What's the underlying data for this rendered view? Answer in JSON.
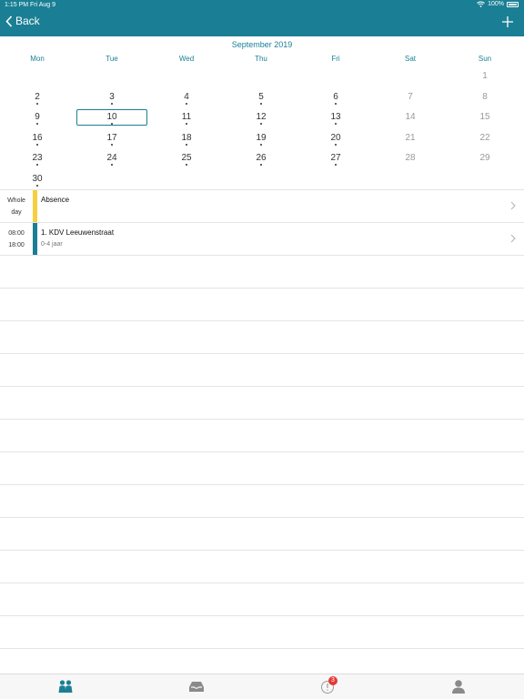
{
  "status_bar": {
    "time": "1:15 PM",
    "date": "Fri Aug 9",
    "battery": "100%"
  },
  "nav": {
    "back_label": "Back",
    "add_icon": "plus-icon"
  },
  "calendar": {
    "month": "September 2019",
    "weekdays": [
      "Mon",
      "Tue",
      "Wed",
      "Thu",
      "Fri",
      "Sat",
      "Sun"
    ],
    "selected_day": "10",
    "weeks": [
      [
        "",
        "",
        "",
        "",
        "",
        "",
        "1"
      ],
      [
        "2",
        "3",
        "4",
        "5",
        "6",
        "7",
        "8"
      ],
      [
        "9",
        "10",
        "11",
        "12",
        "13",
        "14",
        "15"
      ],
      [
        "16",
        "17",
        "18",
        "19",
        "20",
        "21",
        "22"
      ],
      [
        "23",
        "24",
        "25",
        "26",
        "27",
        "28",
        "29"
      ],
      [
        "30",
        "",
        "",
        "",
        "",
        "",
        ""
      ]
    ],
    "days_with_events": [
      "2",
      "3",
      "4",
      "5",
      "6",
      "9",
      "10",
      "11",
      "12",
      "13",
      "16",
      "17",
      "18",
      "19",
      "20",
      "23",
      "24",
      "25",
      "26",
      "27",
      "30"
    ]
  },
  "events": [
    {
      "time1": "Whole",
      "time2": "day",
      "title": "Absence",
      "subtitle": "",
      "color": "#f4d03f"
    },
    {
      "time1": "08:00",
      "time2": "18:00",
      "title": "1. KDV Leeuwenstraat",
      "subtitle": "0-4 jaar",
      "color": "#1a7f94"
    }
  ],
  "tab_bar": {
    "tabs": [
      {
        "icon": "children-icon",
        "active": true
      },
      {
        "icon": "inbox-icon",
        "active": false
      },
      {
        "icon": "alert-icon",
        "active": false,
        "badge": "3"
      },
      {
        "icon": "profile-icon",
        "active": false
      }
    ]
  },
  "colors": {
    "primary": "#1a7f94",
    "absence": "#f4d03f",
    "badge": "#e53935"
  }
}
